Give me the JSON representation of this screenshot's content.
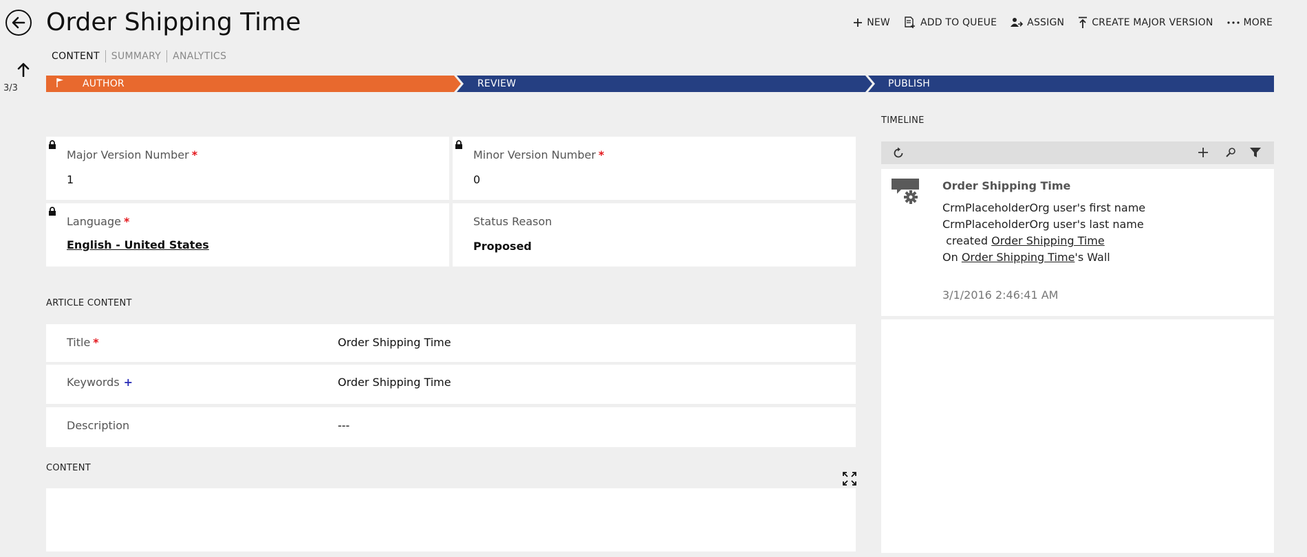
{
  "header": {
    "title": "Order Shipping Time",
    "pager": "3/3",
    "tabs": [
      "CONTENT",
      "SUMMARY",
      "ANALYTICS"
    ],
    "commands": {
      "new": "NEW",
      "add_to_queue": "ADD TO QUEUE",
      "assign": "ASSIGN",
      "create_major_version": "CREATE MAJOR VERSION",
      "more": "MORE"
    }
  },
  "stages": {
    "author": "AUTHOR",
    "review": "REVIEW",
    "publish": "PUBLISH",
    "active_color": "#e8692e",
    "inactive_color": "#253f82"
  },
  "fields": {
    "major_version": {
      "label": "Major Version Number",
      "required_mark": "*",
      "value": "1"
    },
    "minor_version": {
      "label": "Minor Version Number",
      "required_mark": "*",
      "value": "0"
    },
    "language": {
      "label": "Language",
      "required_mark": "*",
      "value": "English - United States"
    },
    "status_reason": {
      "label": "Status Reason",
      "value": "Proposed"
    }
  },
  "article_content": {
    "heading": "ARTICLE CONTENT",
    "title": {
      "label": "Title",
      "required_mark": "*",
      "value": "Order Shipping Time"
    },
    "keywords": {
      "label": "Keywords",
      "recommended_mark": "+",
      "value": "Order Shipping Time"
    },
    "description": {
      "label": "Description",
      "value": "---"
    }
  },
  "content": {
    "heading": "CONTENT"
  },
  "timeline": {
    "heading": "TIMELINE",
    "post": {
      "title": "Order Shipping Time",
      "line1": "CrmPlaceholderOrg user's first name CrmPlaceholderOrg user's last name",
      "created_prefix": "created",
      "created_link": "Order Shipping Time",
      "on_prefix": "On",
      "on_link": "Order Shipping Time",
      "on_suffix": "'s Wall",
      "timestamp": "3/1/2016 2:46:41 AM"
    }
  }
}
